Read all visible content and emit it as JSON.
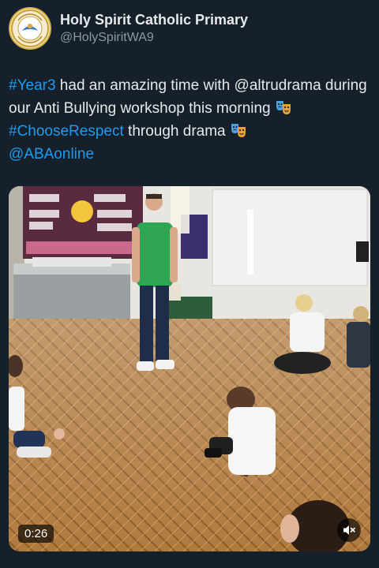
{
  "account": {
    "name": "Holy Spirit Catholic Primary",
    "handle": "@HolySpiritWA9"
  },
  "tweet": {
    "hashtag_year3": "#Year3",
    "text_1": " had an amazing time with @altrudrama during our Anti Bullying workshop this morning ",
    "hashtag_choose": "#ChooseRespect",
    "text_2": " through drama ",
    "mention_aba": "@ABAonline"
  },
  "media": {
    "duration": "0:26"
  },
  "icons": {
    "avatar": "school-crest-icon",
    "emoji": "performing-arts-emoji",
    "mute": "speaker-muted-icon"
  },
  "colors": {
    "background": "#15202b",
    "link": "#1d9bf0",
    "text": "#e7e9ea",
    "secondary": "#8b98a5"
  }
}
